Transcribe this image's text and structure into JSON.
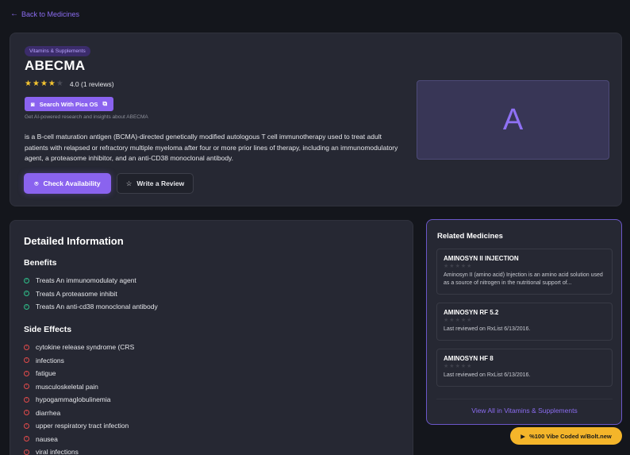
{
  "nav": {
    "back_label": "Back to Medicines"
  },
  "product": {
    "category": "Vitamins & Supplements",
    "title": "ABECMA",
    "rating_value": 4,
    "rating_text": "4.0 (1 reviews)",
    "pica_button": "Search With Pica OS",
    "pica_note": "Get AI-powered research and insights about ABECMA",
    "description": "is a B-cell maturation antigen (BCMA)-directed genetically modified autologous T cell immunotherapy used to treat adult patients with relapsed or refractory multiple myeloma after four or more prior lines of therapy, including an immunomodulatory agent, a proteasome inhibitor, and an anti-CD38 monoclonal antibody.",
    "check_button": "Check Availability",
    "review_button": "Write a Review",
    "thumb_letter": "A"
  },
  "details": {
    "title": "Detailed Information",
    "benefits_title": "Benefits",
    "benefits": [
      "Treats An immunomodulaty agent",
      "Treats A proteasome inhibit",
      "Treats An anti-cd38 monoclonal antibody"
    ],
    "side_effects_title": "Side Effects",
    "side_effects": [
      "cytokine release syndrome (CRS",
      "infections",
      "fatigue",
      "musculoskeletal pain",
      "hypogammaglobulinemia",
      "diarrhea",
      "upper respiratory tract infection",
      "nausea",
      "viral infections"
    ]
  },
  "related": {
    "title": "Related Medicines",
    "items": [
      {
        "name": "AMINOSYN II INJECTION",
        "text": "Aminosyn II (amino acid) Injection is an amino acid solution used as a source of nitrogen in the nutritional support of..."
      },
      {
        "name": "AMINOSYN RF 5.2",
        "text": "Last reviewed on RxList 6/13/2016."
      },
      {
        "name": "AMINOSYN HF 8",
        "text": "Last reviewed on RxList 6/13/2016."
      }
    ],
    "view_all": "View All in Vitamins & Supplements"
  },
  "badge": {
    "label": "%100 Vibe Coded w/Bolt.new"
  },
  "colors": {
    "accent": "#8a63ef",
    "background": "#14161c",
    "card": "#262833",
    "star": "#f4c430",
    "badge": "#f4b52a"
  }
}
